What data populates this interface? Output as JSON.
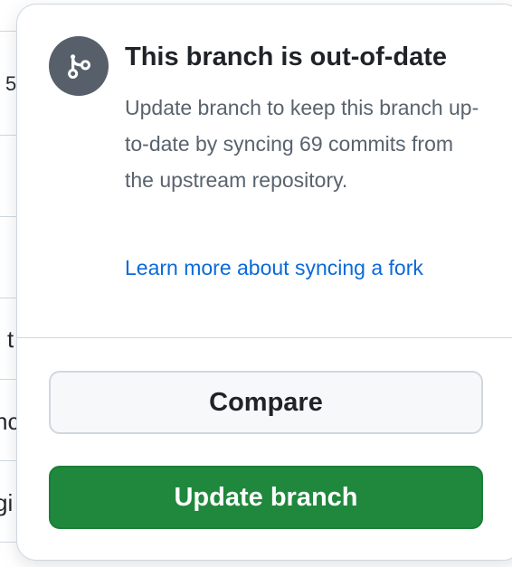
{
  "background_list": {
    "row_fragments": [
      "5",
      "t",
      "nc",
      "gi"
    ]
  },
  "popover": {
    "icon": "git-branch-icon",
    "title": "This branch is out-of-date",
    "description": "Update branch to keep this branch up-to-date by syncing 69 commits from the upstream repository.",
    "learn_more_link": "Learn more about syncing a fork",
    "compare_button": "Compare",
    "update_button": "Update branch"
  },
  "colors": {
    "update_button": "#1f883d",
    "link": "#0969da",
    "icon_background": "#57606a"
  }
}
